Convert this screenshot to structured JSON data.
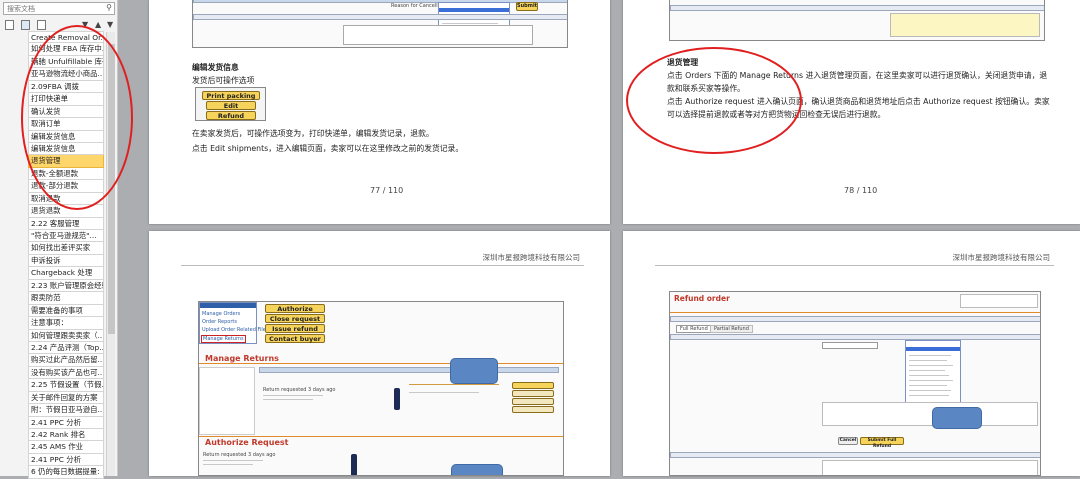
{
  "nav": {
    "search_placeholder": "搜索文档",
    "items": [
      "Create Removal Or...",
      "如何处理 FBA 库存中...",
      "辆驰 Unfulfillable 库存",
      "亚马逊物流经小商品...",
      "2.09FBA 调拨",
      "打印快递单",
      "确认发货",
      "取消订单",
      "编辑发货信息",
      "编辑发货信息",
      "退货管理",
      "退款-全额退款",
      "退款-部分退款",
      "取消退款",
      "退货退款",
      "2.22 客服管理",
      "\"符合亚马逊规范\"...",
      "如何找出差评买家",
      "申诉投诉",
      "Chargeback 处理",
      "2.23 账户管理原会经验",
      "跟卖防范",
      "需要准备的事项",
      "注意事项：",
      "如何管理跟卖卖家（...",
      "2.24 产品评测（Top...",
      "购买过此产品然后留...",
      "没有购买该产品也可...",
      "2.25 节假设置（节假...",
      "关于邮件回复的方案",
      "附：节假日亚马逊自...",
      "2.41 PPC 分析",
      "2.42 Rank 排名",
      "2.45 AMS 作业",
      "2.41 PPC 分析",
      "6 仍的每日数据提量:"
    ],
    "selected_index": 10
  },
  "pages": {
    "p1": {
      "number": "77 / 110",
      "heading": "编辑发货信息",
      "line1": "发货后可操作选项",
      "buttons": [
        "Print packing slip",
        "Edit shipments",
        "Refund order"
      ],
      "para1": "在卖家发货后，可操作选项变为，打印快递单，编辑发货记录，退款。",
      "para2": "点击 Edit shipments，进入编辑页面，卖家可以在这里修改之前的发货记录。",
      "shot_label": "Reason for Cancellation",
      "shot_button": "Submit"
    },
    "p2": {
      "number": "78 / 110",
      "heading": "退货管理",
      "para1": "点击 Orders 下面的 Manage Returns 进入退货管理页面，在这里卖家可以进行退货确认，关闭退货申请，退款和联系买家等操作。",
      "para2": "点击 Authorize request 进入确认页面，确认退货商品和退货地址后点击 Authorize request 按钮确认。卖家可以选择提前退款或者等对方把货物运回检查无误后进行退款。"
    },
    "p3": {
      "header": "深圳市星报跨境科技有限公司",
      "menu": [
        "Manage Orders",
        "Order Reports",
        "Upload Order Related Files",
        "Manage Returns"
      ],
      "actions": [
        "Authorize request",
        "Close request",
        "Issue refund",
        "Contact buyer"
      ],
      "title1": "Manage Returns",
      "title2": "Authorize Request",
      "row1": "Return requested 3 days ago",
      "row2": "Return requested 3 days ago"
    },
    "p4": {
      "header": "深圳市星报跨境科技有限公司",
      "title": "Refund order",
      "tab1": "Full Refund",
      "tab2": "Partial Refund",
      "btn_cancel": "Cancel",
      "btn_submit": "Submit Full Refund"
    }
  }
}
